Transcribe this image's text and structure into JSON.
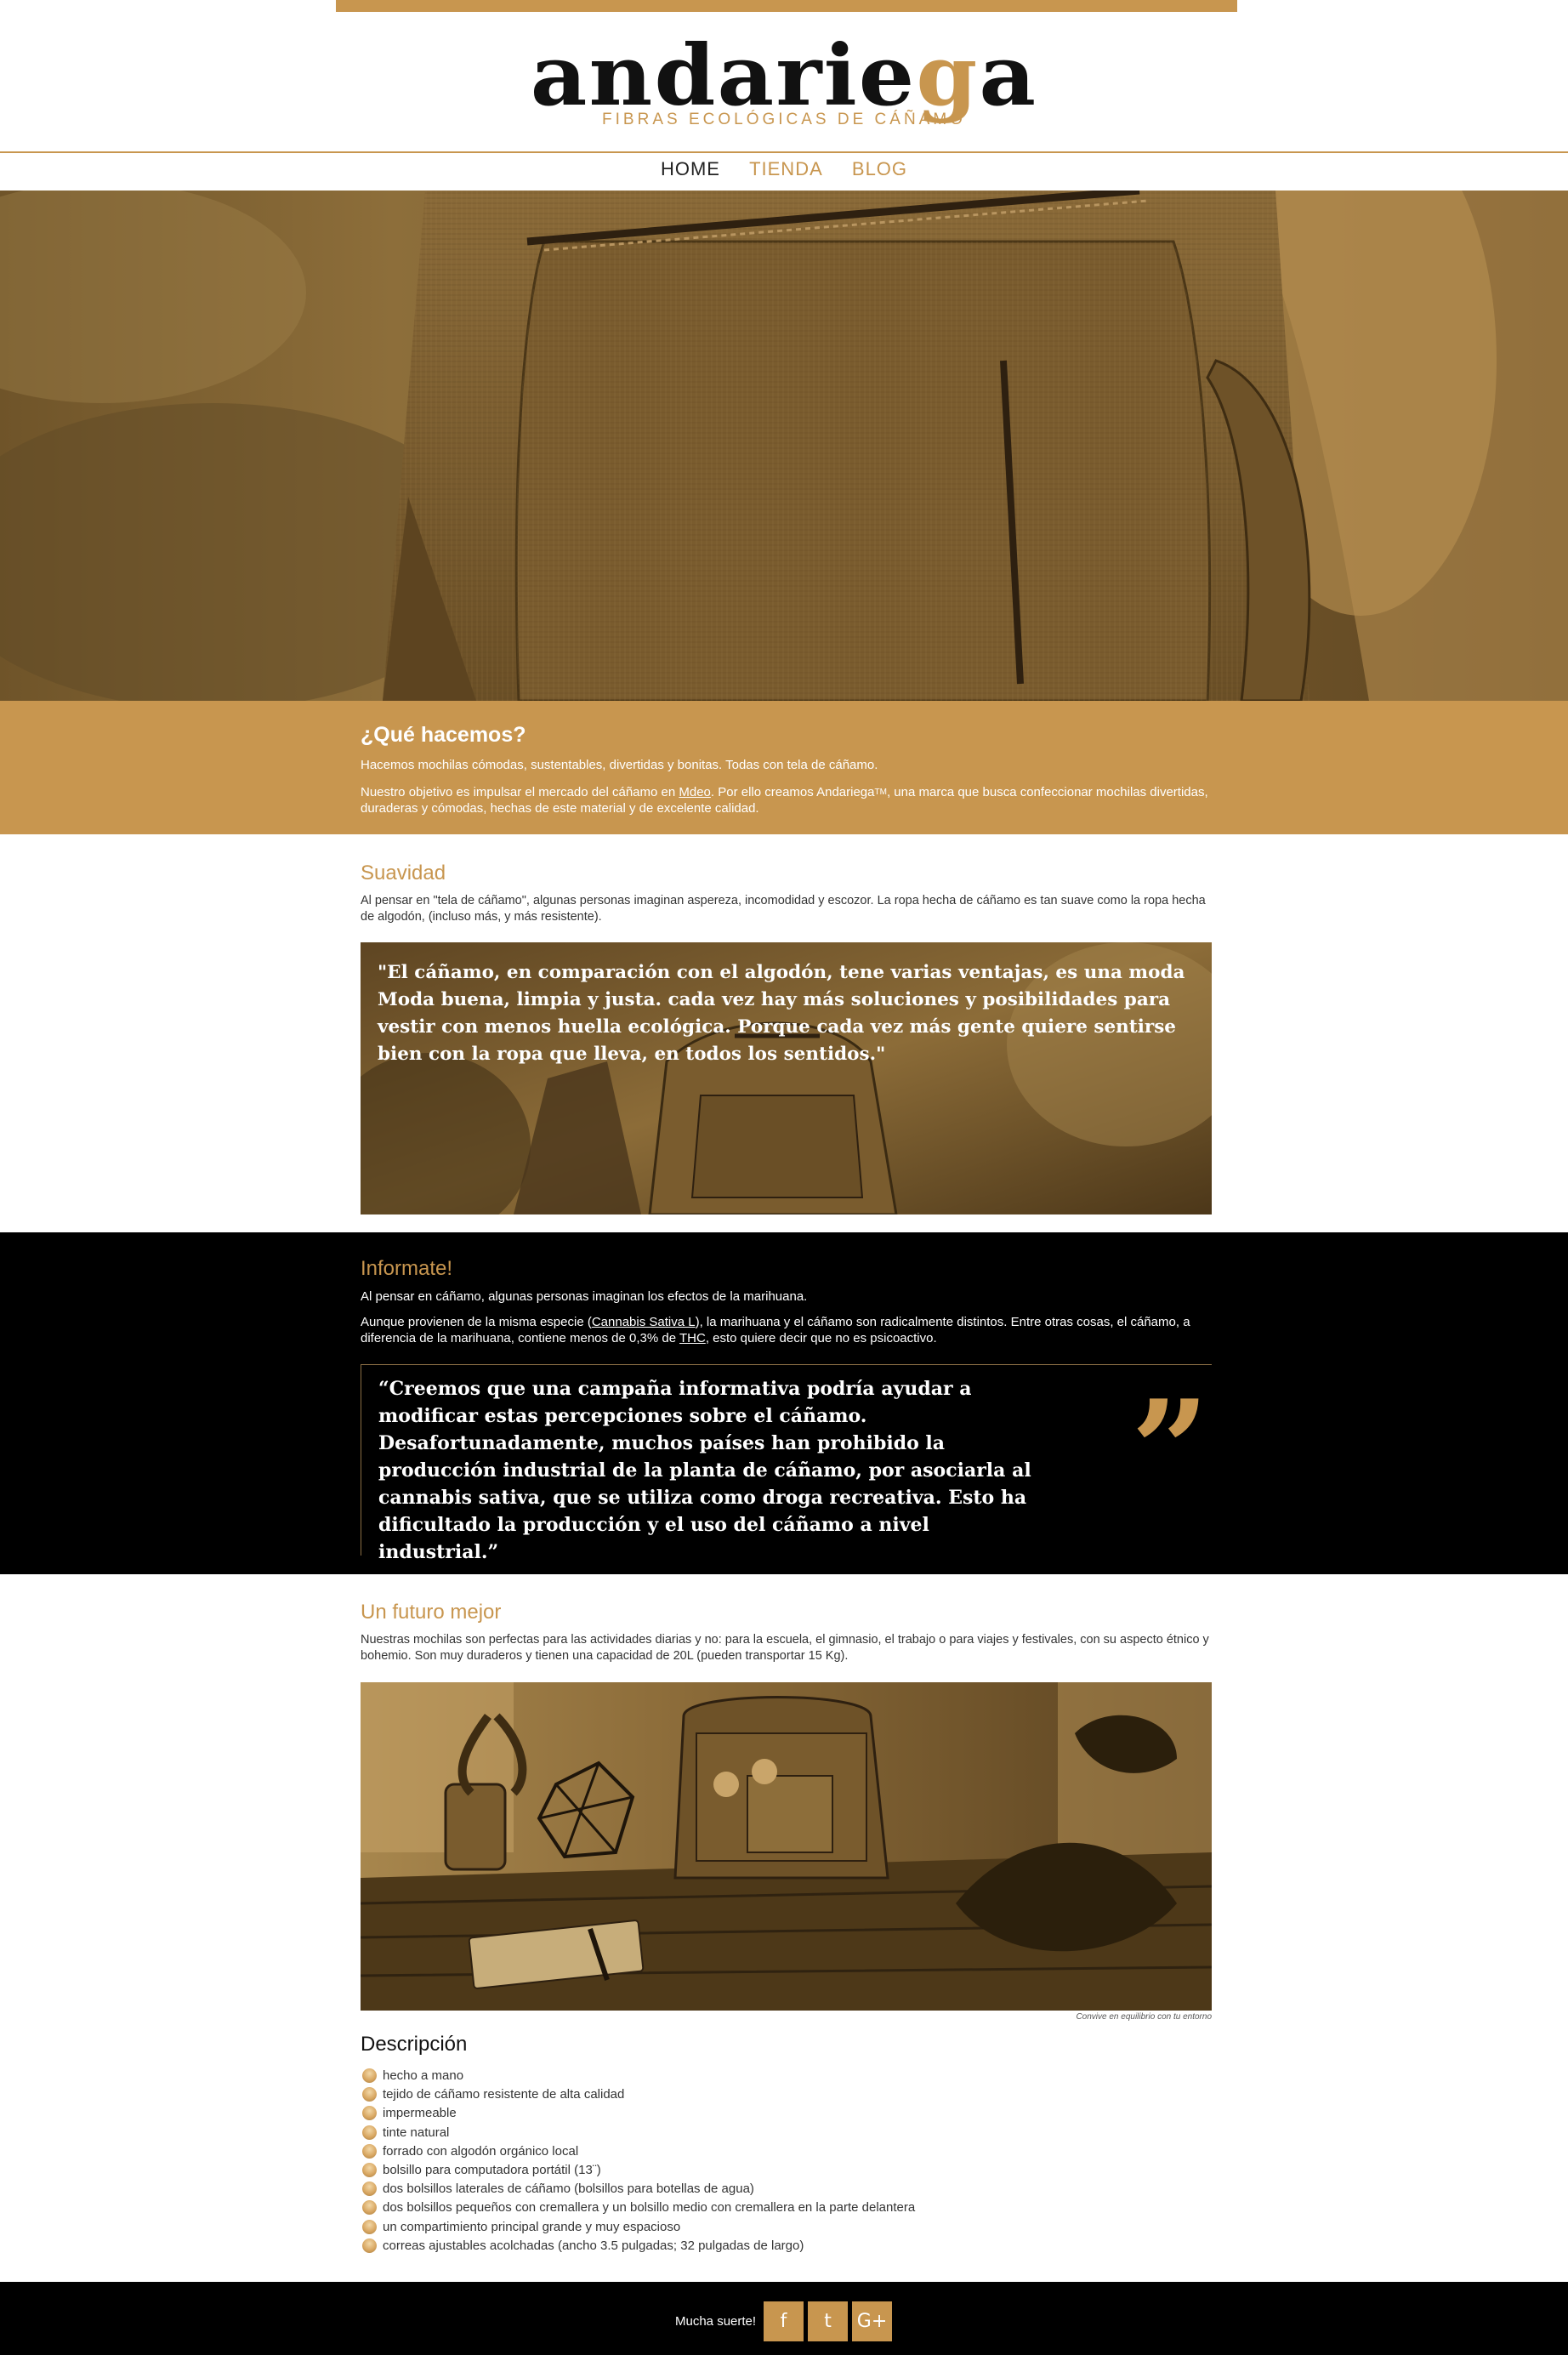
{
  "brand": {
    "name_pre": "andarie",
    "name_g": "g",
    "name_post": "a",
    "tagline": "FIBRAS ECOLÓGICAS DE CÁÑAMO"
  },
  "nav": {
    "home": "HOME",
    "tienda": "TIENDA",
    "blog": "BLOG"
  },
  "que_hacemos": {
    "title": "¿Qué hacemos?",
    "p1": "Hacemos mochilas cómodas, sustentables, divertidas y bonitas. Todas con tela de cáñamo.",
    "p2_a": "Nuestro objetivo es impulsar el mercado del cáñamo en ",
    "p2_link": "Mdeo",
    "p2_b": ". Por ello creamos Andariega",
    "p2_tm": "TM",
    "p2_c": ", una marca que busca confeccionar mochilas divertidas, duraderas y cómodas, hechas de este material y de excelente calidad."
  },
  "suavidad": {
    "title": "Suavidad",
    "p": "Al pensar en \"tela de cáñamo\", algunas personas imaginan aspereza, incomodidad y escozor. La ropa hecha de cáñamo es tan suave como la ropa hecha de algodón, (incluso más, y más resistente).",
    "quote": "\"El cáñamo, en comparación con el algodón, tene varias ventajas, es una moda Moda buena, limpia y justa. cada vez hay más soluciones y posibilidades para vestir con menos huella ecológica. Porque cada vez más gente quiere sentirse bien con la ropa que lleva, en todos los sentidos.\""
  },
  "informate": {
    "title": "Informate!",
    "p1": "Al pensar en cáñamo, algunas personas imaginan los efectos de la marihuana.",
    "p2_a": "Aunque provienen de la misma especie (",
    "p2_link1": "Cannabis Sativa L",
    "p2_b": "), la marihuana y el cáñamo son radicalmente distintos. Entre otras cosas, el cáñamo, a diferencia de la marihuana, contiene menos de 0,3% de ",
    "p2_link2": "THC",
    "p2_c": ", esto quiere decir que no es psicoactivo.",
    "quote": "“Creemos que una campaña informativa podría ayudar a modificar estas percepciones sobre el cáñamo. Desafortunadamente, muchos países han prohibido la producción industrial de la planta de cáñamo, por asociarla al cannabis sativa, que se utiliza como droga recreativa. Esto ha dificultado la producción y el uso del cáñamo a nivel industrial.”",
    "quote_mark": "”"
  },
  "futuro": {
    "title": "Un futuro mejor",
    "p": "Nuestras mochilas son perfectas para las actividades diarias y no: para la escuela, el gimnasio, el trabajo o para viajes y festivales, con su aspecto étnico y bohemio. Son muy duraderos y tienen una capacidad de 20L (pueden transportar 15 Kg).",
    "caption": "Convive en equilibrio con tu entorno",
    "desc_title": "Descripción",
    "items": [
      "hecho a mano",
      "tejido de cáñamo resistente de alta calidad",
      "impermeable",
      "tinte natural",
      "forrado con algodón orgánico local",
      "bolsillo para computadora portátil (13¨)",
      "dos bolsillos laterales de cáñamo (bolsillos para botellas de agua)",
      "dos bolsillos pequeños con cremallera y un bolsillo medio con cremallera en la parte delantera",
      "un compartimiento principal grande y muy espacioso",
      "correas ajustables acolchadas (ancho 3.5 pulgadas; 32 pulgadas de largo)"
    ]
  },
  "footer": {
    "text": "Mucha suerte!",
    "facebook": "f",
    "twitter": "t",
    "gplus": "G+"
  },
  "colors": {
    "accent": "#c8964f",
    "dark": "#000000",
    "text": "#333333"
  }
}
